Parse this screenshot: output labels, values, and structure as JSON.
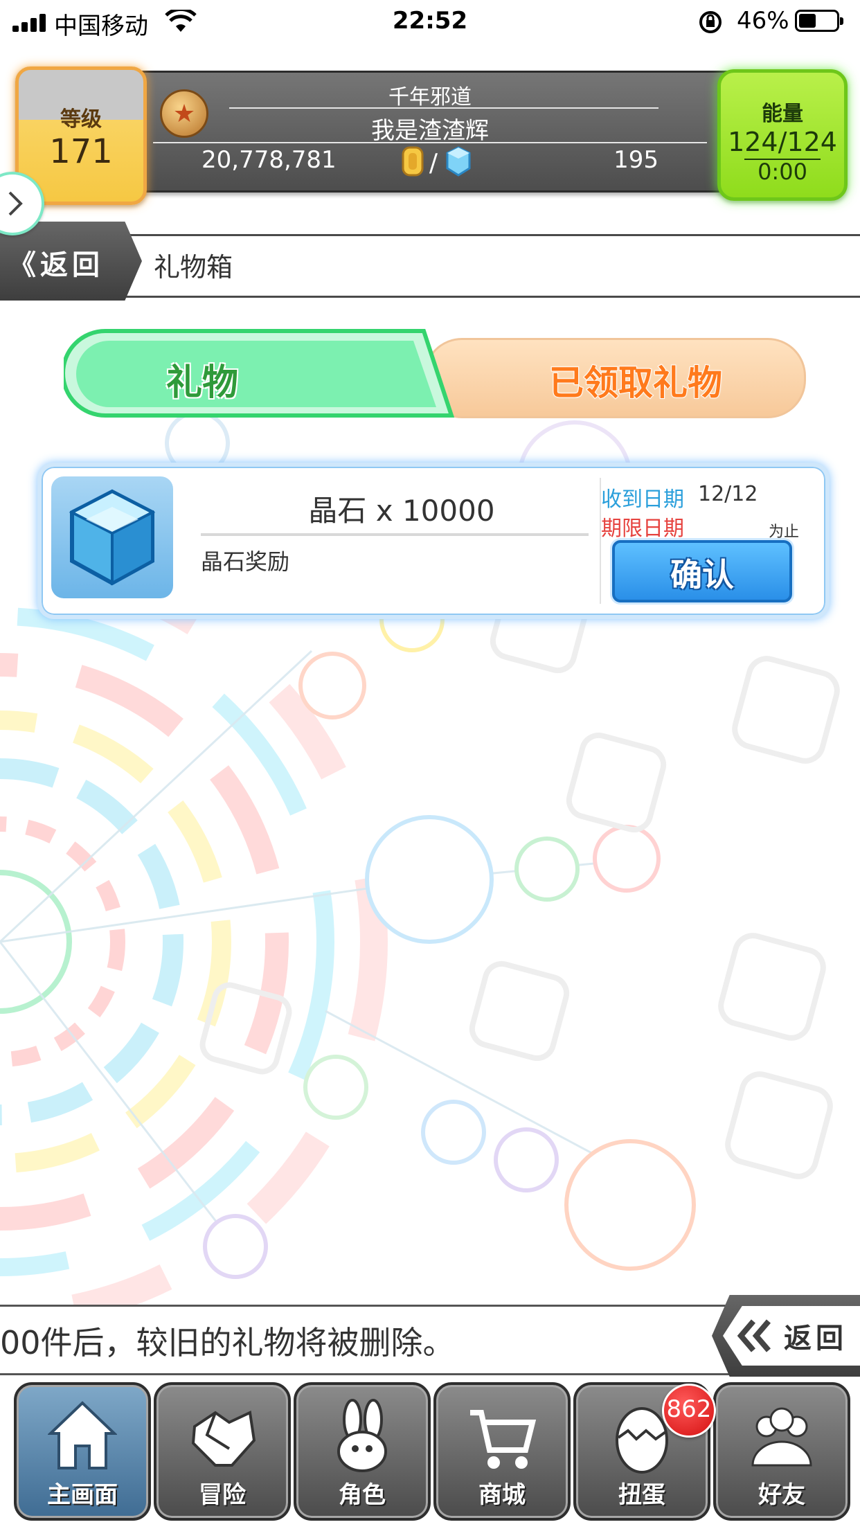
{
  "status_bar": {
    "carrier": "中国移动",
    "time": "22:52",
    "battery_percent": "46%",
    "battery_level": 0.46
  },
  "header": {
    "level_label": "等级",
    "level_value": "171",
    "title": "千年邪道",
    "player_name": "我是渣渣辉",
    "gold": "20,778,781",
    "currency_separator": "/",
    "gems": "195",
    "energy_label": "能量",
    "energy_value": "124/124",
    "energy_timer": "0:00"
  },
  "nav": {
    "back_label": "返回",
    "page_title": "礼物箱"
  },
  "tabs": [
    {
      "label": "礼物",
      "active": true
    },
    {
      "label": "已领取礼物",
      "active": false
    }
  ],
  "gifts": [
    {
      "name": "晶石 x 10000",
      "description": "晶石奖励",
      "received_label": "收到日期",
      "received_date": "12/12",
      "expire_label": "期限日期",
      "expire_suffix": "为止",
      "confirm_label": "确认",
      "icon": "crystal-cube-icon"
    }
  ],
  "info_bar": {
    "message": "00件后，较旧的礼物将被删除。",
    "back_label": "返回"
  },
  "bottom_nav": [
    {
      "label": "主画面",
      "icon": "home-icon",
      "active": true
    },
    {
      "label": "冒险",
      "icon": "handshake-icon",
      "active": false
    },
    {
      "label": "角色",
      "icon": "rabbit-icon",
      "active": false
    },
    {
      "label": "商城",
      "icon": "cart-icon",
      "active": false
    },
    {
      "label": "扭蛋",
      "icon": "egg-icon",
      "active": false
    },
    {
      "label": "好友",
      "icon": "friends-icon",
      "active": false
    }
  ],
  "gacha_badge": "862",
  "colors": {
    "tab_active": "#7cf0b0",
    "tab_inactive": "#f7c99a",
    "confirm_button": "#2a8fe8",
    "energy": "#8fdc1c",
    "level": "#f6c843"
  }
}
